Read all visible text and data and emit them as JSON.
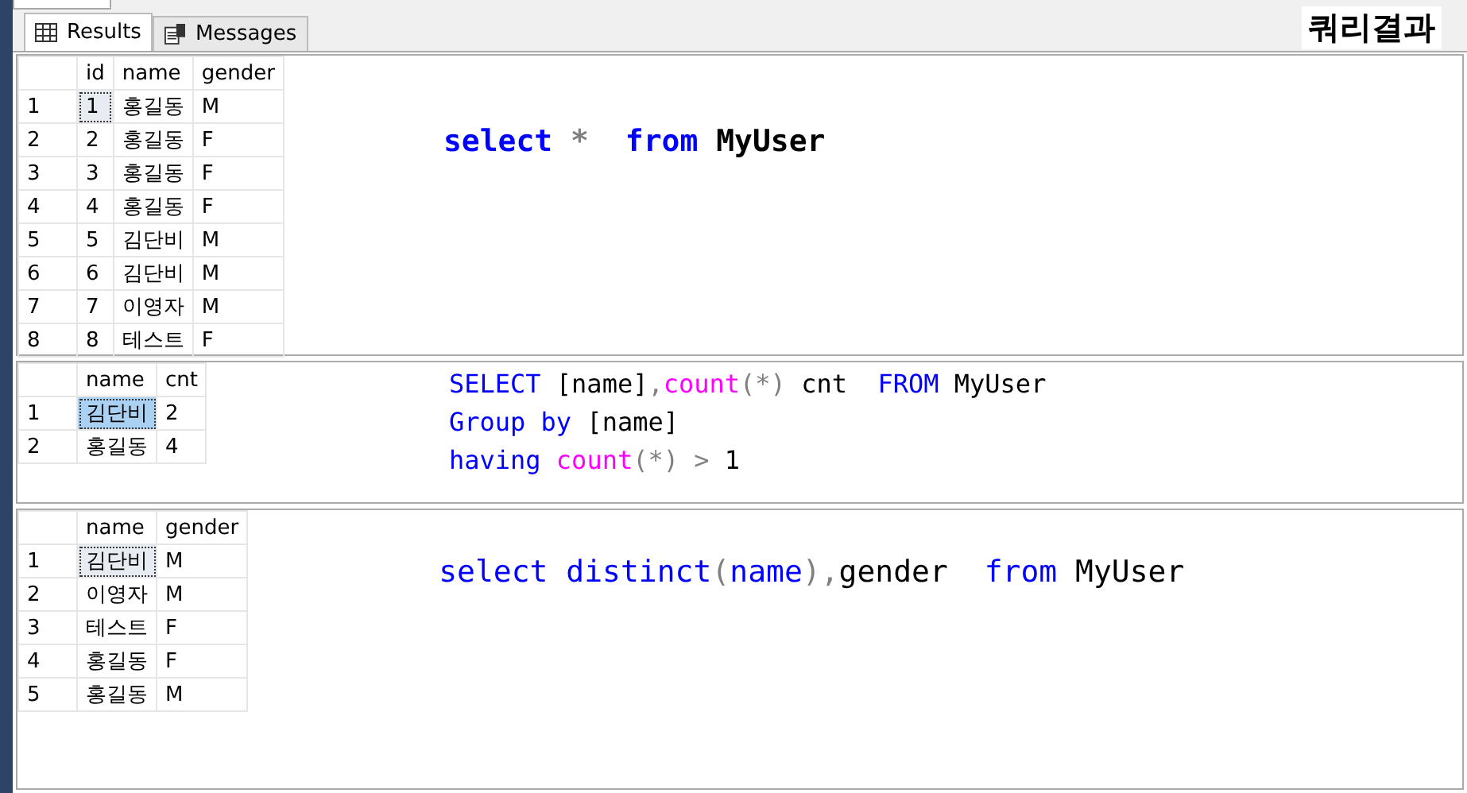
{
  "caption": "쿼리결과",
  "tabs": [
    {
      "label": "Results",
      "selected": true,
      "kind": "grid"
    },
    {
      "label": "Messages",
      "selected": false,
      "kind": "messages"
    }
  ],
  "panels": [
    {
      "highlighted": false,
      "columns": [
        "id",
        "name",
        "gender"
      ],
      "rows": [
        {
          "number": "1",
          "cells": [
            "1",
            "홍길동",
            "M"
          ],
          "selected": true
        },
        {
          "number": "2",
          "cells": [
            "2",
            "홍길동",
            "F"
          ],
          "selected": false
        },
        {
          "number": "3",
          "cells": [
            "3",
            "홍길동",
            "F"
          ],
          "selected": false
        },
        {
          "number": "4",
          "cells": [
            "4",
            "홍길동",
            "F"
          ],
          "selected": false
        },
        {
          "number": "5",
          "cells": [
            "5",
            "김단비",
            "M"
          ],
          "selected": false
        },
        {
          "number": "6",
          "cells": [
            "6",
            "김단비",
            "M"
          ],
          "selected": false
        },
        {
          "number": "7",
          "cells": [
            "7",
            "이영자",
            "M"
          ],
          "selected": false
        },
        {
          "number": "8",
          "cells": [
            "8",
            "테스트",
            "F"
          ],
          "selected": false
        }
      ],
      "kind": "bold",
      "query": [
        [
          {
            "text": "select",
            "kind": "keyword"
          },
          {
            "text": " * ",
            "kind": "operator"
          },
          {
            "text": " from",
            "kind": "keyword"
          },
          {
            "text": " MyUser",
            "kind": "plain"
          }
        ]
      ]
    },
    {
      "highlighted": true,
      "columns": [
        "name",
        "cnt"
      ],
      "rows": [
        {
          "number": "1",
          "cells": [
            "김단비",
            "2"
          ],
          "selected": true
        },
        {
          "number": "2",
          "cells": [
            "홍길동",
            "4"
          ],
          "selected": false
        }
      ],
      "kind": "small",
      "query": [
        [
          {
            "text": "SELECT",
            "kind": "keyword"
          },
          {
            "text": " [name]",
            "kind": "plain"
          },
          {
            "text": ",",
            "kind": "operator"
          },
          {
            "text": "count",
            "kind": "function"
          },
          {
            "text": "(*)",
            "kind": "operator"
          },
          {
            "text": " cnt  ",
            "kind": "plain"
          },
          {
            "text": "FROM",
            "kind": "keyword"
          },
          {
            "text": " MyUser",
            "kind": "plain"
          }
        ],
        [
          {
            "text": "Group by",
            "kind": "keyword"
          },
          {
            "text": " [name]",
            "kind": "plain"
          }
        ],
        [
          {
            "text": "having ",
            "kind": "keyword"
          },
          {
            "text": "count",
            "kind": "function"
          },
          {
            "text": "(*) > ",
            "kind": "operator"
          },
          {
            "text": "1",
            "kind": "plain"
          }
        ]
      ]
    },
    {
      "highlighted": false,
      "columns": [
        "name",
        "gender"
      ],
      "rows": [
        {
          "number": "1",
          "cells": [
            "김단비",
            "M"
          ],
          "selected": true
        },
        {
          "number": "2",
          "cells": [
            "이영자",
            "M"
          ],
          "selected": false
        },
        {
          "number": "3",
          "cells": [
            "테스트",
            "F"
          ],
          "selected": false
        },
        {
          "number": "4",
          "cells": [
            "홍길동",
            "F"
          ],
          "selected": false
        },
        {
          "number": "5",
          "cells": [
            "홍길동",
            "M"
          ],
          "selected": false
        }
      ],
      "kind": "regular",
      "query": [
        [
          {
            "text": "select distinct",
            "kind": "keyword"
          },
          {
            "text": "(",
            "kind": "operator"
          },
          {
            "text": "name",
            "kind": "keyword"
          },
          {
            "text": "),",
            "kind": "operator"
          },
          {
            "text": "gender  ",
            "kind": "plain"
          },
          {
            "text": "from",
            "kind": "keyword"
          },
          {
            "text": " MyUser",
            "kind": "plain"
          }
        ]
      ]
    }
  ]
}
